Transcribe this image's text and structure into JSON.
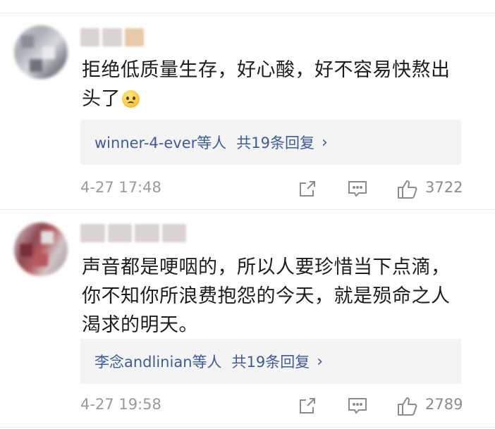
{
  "comments": [
    {
      "text_line1": "拒绝低质量生存，好心酸，好不容易快熬出",
      "text_line2": "头了",
      "emoji": "sad-face-emoji",
      "replies_names": "winner-4-ever等人",
      "replies_count": "共19条回复",
      "replies_chevron": "›",
      "time": "4-27 17:48",
      "likes": "3722"
    },
    {
      "text_line1": "声音都是哽咽的，所以人要珍惜当下点滴，",
      "text_line2": "你不知你所浪费抱怨的今天，就是殒命之人",
      "text_line3": "渴求的明天。",
      "replies_names": "李念andlinian等人",
      "replies_count": "共19条回复",
      "replies_chevron": "›",
      "time": "4-27 19:58",
      "likes": "2789"
    }
  ],
  "icons": {
    "share": "share-icon",
    "comment": "comment-icon",
    "like": "thumbs-up-icon"
  },
  "colors": {
    "link": "#3d5a9c",
    "meta": "#9a9a9a",
    "reply_bg": "#f4f4f4"
  }
}
